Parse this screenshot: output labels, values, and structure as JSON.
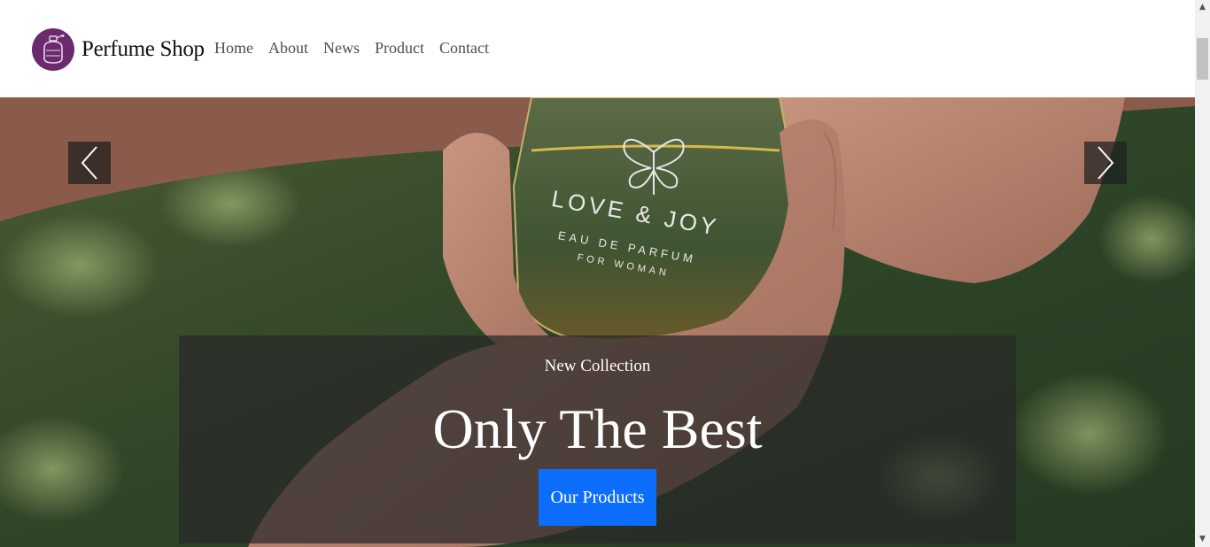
{
  "brand": {
    "name": "Perfume Shop",
    "logo_icon": "perfume-bottle-icon",
    "logo_color": "#6b2a6e"
  },
  "nav": {
    "items": [
      {
        "label": "Home"
      },
      {
        "label": "About"
      },
      {
        "label": "News"
      },
      {
        "label": "Product"
      },
      {
        "label": "Contact"
      }
    ]
  },
  "hero": {
    "bottle_text": {
      "line1": "LOVE & JOY",
      "line2": "EAU DE PARFUM",
      "line3": "FOR WOMAN"
    },
    "prev_icon": "chevron-left-icon",
    "next_icon": "chevron-right-icon",
    "caption": {
      "subtitle": "New Collection",
      "title": "Only The Best",
      "button_label": "Our Products",
      "button_color": "#0d6efd"
    }
  }
}
